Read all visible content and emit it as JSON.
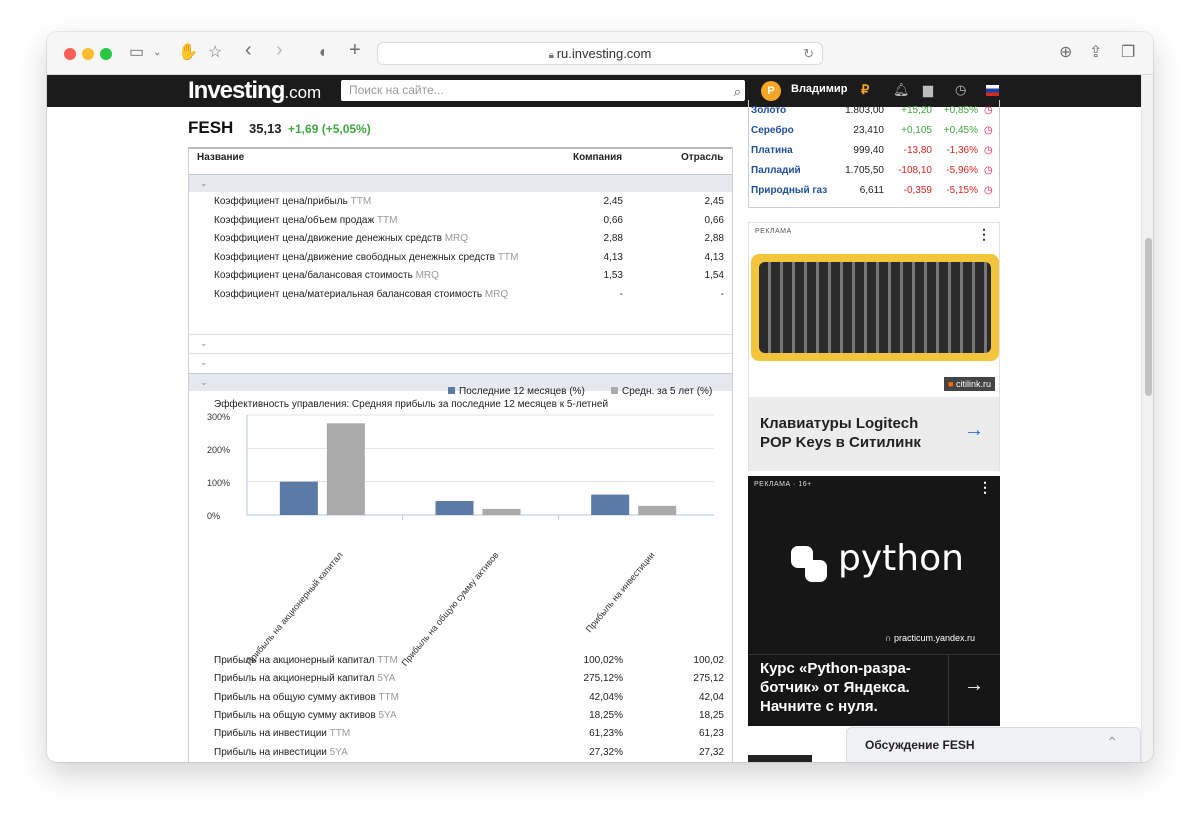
{
  "browser": {
    "url": "ru.investing.com"
  },
  "site": {
    "logo_main": "Investing",
    "logo_suffix": ".com",
    "search_placeholder": "Поиск на сайте...",
    "user_name": "Владимир",
    "avatar_letter": "Р"
  },
  "stock": {
    "ticker": "FESH",
    "price": "35,13",
    "change": "+1,69 (+5,05%)"
  },
  "table": {
    "headers": [
      "Название",
      "Компания",
      "Отрасль"
    ],
    "valuation_rows": [
      {
        "label": "Коэффициент цена/прибыль",
        "tag": "TTM",
        "company": "2,45",
        "industry": "2,45"
      },
      {
        "label": "Коэффициент цена/объем продаж",
        "tag": "TTM",
        "company": "0,66",
        "industry": "0,66"
      },
      {
        "label": "Коэффициент цена/движение денежных средств",
        "tag": "MRQ",
        "company": "2,88",
        "industry": "2,88"
      },
      {
        "label": "Коэффициент цена/движение свободных денежных средств",
        "tag": "TTM",
        "company": "4,13",
        "industry": "4,13"
      },
      {
        "label": "Коэффициент цена/балансовая стоимость",
        "tag": "MRQ",
        "company": "1,53",
        "industry": "1,54"
      },
      {
        "label": "Коэффициент цена/материальная балансовая стоимость",
        "tag": "MRQ",
        "company": "-",
        "industry": "-"
      }
    ],
    "mgmt_rows": [
      {
        "label": "Прибыль на акционерный капитал",
        "tag": "TTM",
        "company": "100,02%",
        "industry": "100,02"
      },
      {
        "label": "Прибыль на акционерный капитал",
        "tag": "5YA",
        "company": "275,12%",
        "industry": "275,12"
      },
      {
        "label": "Прибыль на общую сумму активов",
        "tag": "TTM",
        "company": "42,04%",
        "industry": "42,04"
      },
      {
        "label": "Прибыль на общую сумму активов",
        "tag": "5YA",
        "company": "18,25%",
        "industry": "18,25"
      },
      {
        "label": "Прибыль на инвестиции",
        "tag": "TTM",
        "company": "61,23%",
        "industry": "61,23"
      },
      {
        "label": "Прибыль на инвестиции",
        "tag": "5YA",
        "company": "27,32%",
        "industry": "27,32"
      }
    ]
  },
  "chart_data": {
    "type": "bar",
    "title": "Эффективность управления: Средняя прибыль за последние 12 месяцев к 5-летней",
    "categories": [
      "Прибыль на акционерный капитал",
      "Прибыль на общую сумму активов",
      "Прибыль на инвестиции"
    ],
    "series": [
      {
        "name": "Последние 12 месяцев (%)",
        "values": [
          100.02,
          42.04,
          61.23
        ],
        "color": "#5b7aa6"
      },
      {
        "name": "Средн. за 5 лет (%)",
        "values": [
          275.12,
          18.25,
          27.32
        ],
        "color": "#aaaaaa"
      }
    ],
    "yticks": [
      "300%",
      "200%",
      "100%",
      "0%"
    ],
    "ylim": [
      0,
      300
    ],
    "legend": "top-right",
    "grid": true
  },
  "commodities": [
    {
      "name": "Золото",
      "price": "1.803,00",
      "chg": "+15,20",
      "pct": "+0,85%",
      "color": "#3ea83e"
    },
    {
      "name": "Серебро",
      "price": "23,410",
      "chg": "+0,105",
      "pct": "+0,45%",
      "color": "#3ea83e"
    },
    {
      "name": "Платина",
      "price": "999,40",
      "chg": "-13,80",
      "pct": "-1,36%",
      "color": "#e0231c"
    },
    {
      "name": "Палладий",
      "price": "1.705,50",
      "chg": "-108,10",
      "pct": "-5,96%",
      "color": "#e0231c"
    },
    {
      "name": "Природный газ",
      "price": "6,611",
      "chg": "-0,359",
      "pct": "-5,15%",
      "color": "#e0231c"
    }
  ],
  "ad1": {
    "label": "РЕКЛАМА",
    "source": "citilink.ru",
    "headline": "Клавиатуры Logitech POP Keys в Ситилинк"
  },
  "ad2": {
    "label": "РЕКЛАМА · 16+",
    "brand": "python",
    "source": "practicum.yandex.ru",
    "headline": "Курс «Python-разра­ботчик» от Яндекса. Начните с нуля."
  },
  "discussion": {
    "title": "Обсуждение FESH"
  }
}
